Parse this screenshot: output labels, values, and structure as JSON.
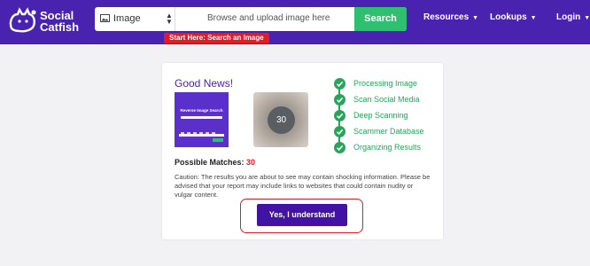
{
  "brand": {
    "name_line1": "Social",
    "name_line2": "Catfish"
  },
  "search": {
    "type_label": "Image",
    "upload_placeholder": "Browse and upload image here",
    "button": "Search",
    "hint": "Start Here: Search an Image"
  },
  "nav": {
    "resources": "Resources",
    "lookups": "Lookups",
    "login": "Login"
  },
  "result": {
    "heading": "Good News!",
    "thumbnail_title": "Reverse Image Search",
    "blurred_count": "30",
    "steps": [
      "Processing Image",
      "Scan Social Media",
      "Deep Scanning",
      "Scammer Database",
      "Organizing Results"
    ],
    "matches_label": "Possible Matches:",
    "matches_value": "30",
    "caution": "Caution: The results you are about to see may contain shocking information. Please be advised that your report may include links to websites that could contain nudity or vulgar content.",
    "accept_button": "Yes, I understand"
  },
  "colors": {
    "topbar": "#4a22b0",
    "search_green": "#2fbf71",
    "step_green": "#2aa45b",
    "alert_red": "#e31b23",
    "button_purple": "#4212a4"
  }
}
